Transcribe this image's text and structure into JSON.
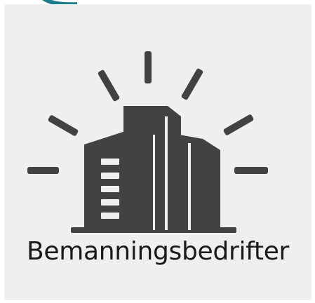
{
  "card": {
    "label": "Bemanningsbedrifter",
    "icon": "office-building-icon",
    "icon_color": "#424242",
    "background": "#efefef"
  },
  "decor": {
    "top_arc_icon": "teal-arc-icon",
    "top_arc_color": "#1c7d8c"
  }
}
